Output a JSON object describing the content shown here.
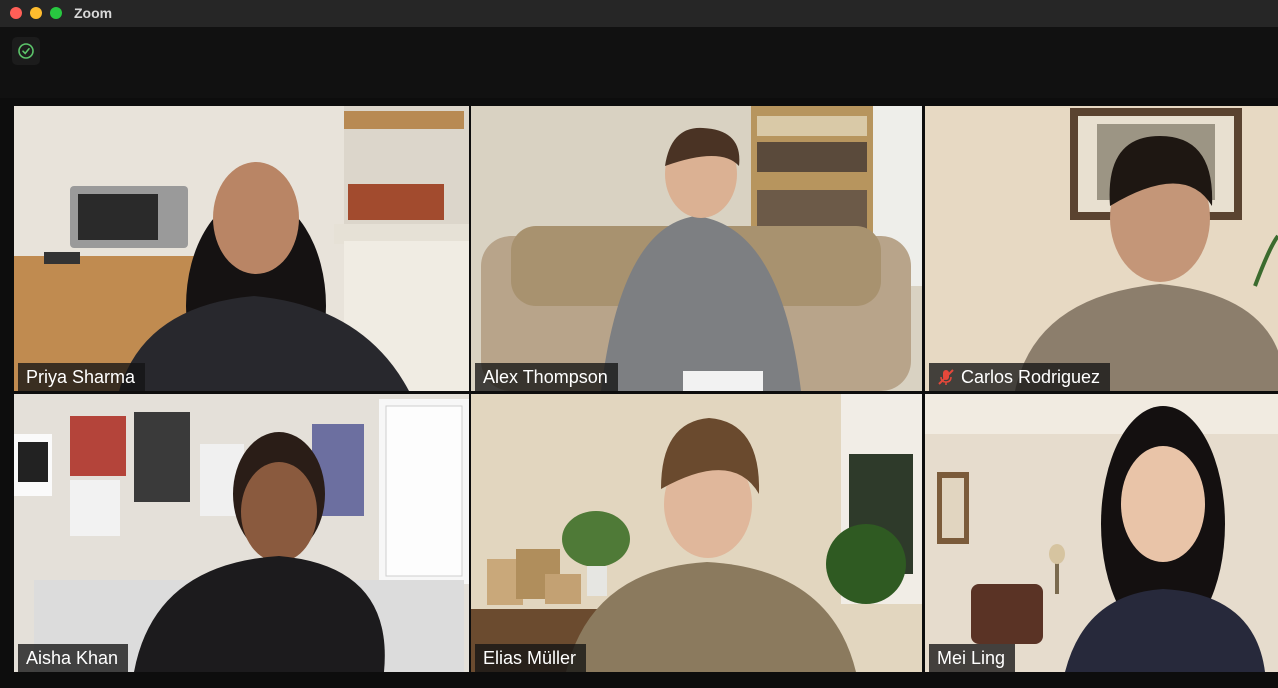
{
  "window": {
    "title": "Zoom"
  },
  "toolbar": {
    "security_icon": "shield-check-icon"
  },
  "participants": [
    {
      "name": "Priya Sharma",
      "active_speaker": true,
      "muted": false
    },
    {
      "name": "Alex Thompson",
      "active_speaker": true,
      "muted": false
    },
    {
      "name": "Carlos Rodriguez",
      "active_speaker": false,
      "muted": true,
      "mute_icon": "microphone-muted-icon"
    },
    {
      "name": "Aisha Khan",
      "active_speaker": false,
      "muted": false
    },
    {
      "name": "Elias Müller",
      "active_speaker": false,
      "muted": false
    },
    {
      "name": "Mei Ling",
      "active_speaker": false,
      "muted": false
    }
  ],
  "colors": {
    "highlight": "#c9dc8f",
    "mute_red": "#e5483b"
  }
}
